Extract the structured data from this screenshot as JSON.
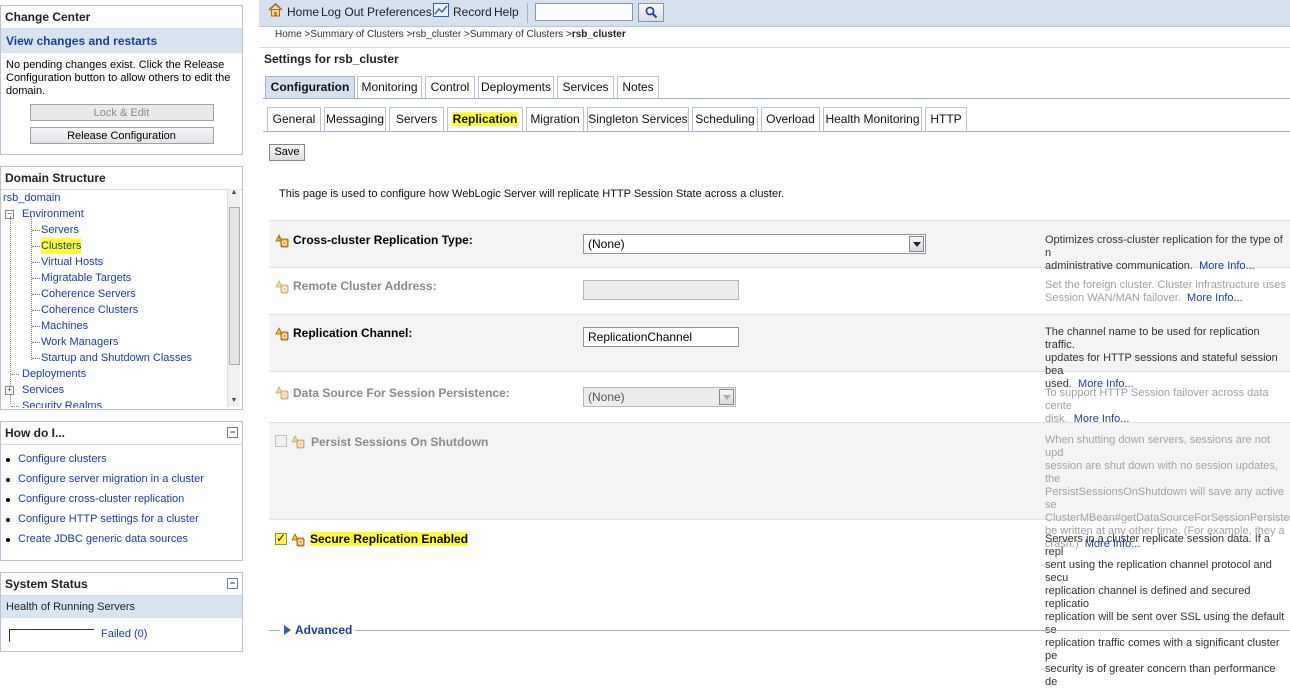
{
  "change_center": {
    "title": "Change Center",
    "view_changes": "View changes and restarts",
    "message": "No pending changes exist. Click the Release Configuration button to allow others to edit the domain.",
    "lock_edit": "Lock & Edit",
    "release": "Release Configuration"
  },
  "domain_structure": {
    "title": "Domain Structure",
    "items": [
      "rsb_domain",
      "Environment",
      "Servers",
      "Clusters",
      "Virtual Hosts",
      "Migratable Targets",
      "Coherence Servers",
      "Coherence Clusters",
      "Machines",
      "Work Managers",
      "Startup and Shutdown Classes",
      "Deployments",
      "Services",
      "Security Realms"
    ]
  },
  "how_do_i": {
    "title": "How do I...",
    "items": [
      "Configure clusters",
      "Configure server migration in a cluster",
      "Configure cross-cluster replication",
      "Configure HTTP settings for a cluster",
      "Create JDBC generic data sources"
    ]
  },
  "system_status": {
    "title": "System Status",
    "health": "Health of Running Servers",
    "failed": "Failed (0)"
  },
  "topbar": {
    "home": "Home",
    "logout": "Log Out",
    "preferences": "Preferences",
    "record": "Record",
    "help": "Help",
    "search_value": ""
  },
  "breadcrumb": {
    "home": "Home",
    "summary_clusters": "Summary of Clusters",
    "cluster": "rsb_cluster",
    "summary_clusters_2": "Summary of Clusters",
    "current": "rsb_cluster"
  },
  "page": {
    "title": "Settings for rsb_cluster",
    "save": "Save",
    "intro": "This page is used to configure how WebLogic Server will replicate HTTP Session State across a cluster."
  },
  "tabs": [
    "Configuration",
    "Monitoring",
    "Control",
    "Deployments",
    "Services",
    "Notes"
  ],
  "subtabs": [
    "General",
    "Messaging",
    "Servers",
    "Replication",
    "Migration",
    "Singleton Services",
    "Scheduling",
    "Overload",
    "Health Monitoring",
    "HTTP"
  ],
  "fields": {
    "cross_cluster": {
      "label": "Cross-cluster Replication Type:",
      "value": "(None)",
      "desc": "Optimizes cross-cluster replication for the type of n\nadministrative communication.",
      "more": "More Info..."
    },
    "remote_address": {
      "label": "Remote Cluster Address:",
      "value": "",
      "desc": "Set the foreign cluster. Cluster infrastructure uses\nSession WAN/MAN failover.",
      "more": "More Info..."
    },
    "replication_channel": {
      "label": "Replication Channel:",
      "value": "ReplicationChannel",
      "desc": "The channel name to be used for replication traffic.\nupdates for HTTP sessions and stateful session bea\nused.",
      "more": "More Info..."
    },
    "data_source": {
      "label": "Data Source For Session Persistence:",
      "value": "(None)",
      "desc": "To support HTTP Session failover across data cente\ndisk.",
      "more": "More Info..."
    },
    "persist_sessions": {
      "label": "Persist Sessions On Shutdown",
      "desc": "When shutting down servers, sessions are not upd\nsession are shut down with no session updates, the\nPersistSessionsOnShutdown will save any active se\nClusterMBean#getDataSourceForSessionPersistenc\nbe written at any other time. (For example, they a\ncrash.)",
      "more": "More Info..."
    },
    "secure_replication": {
      "label": "Secure Replication Enabled",
      "desc": "Servers in a cluster replicate session data. If a repl\nsent using the replication channel protocol and secu\nreplication channel is defined and secured replicatio\nreplication will be sent over SSL using the default se\nreplication traffic comes with a significant cluster pe\nsecurity is of greater concern than performance de"
    }
  },
  "advanced": "Advanced",
  "colors": {
    "header_bg": "#d6e1f0",
    "link": "#1b3e9e",
    "highlight": "#ffff33"
  }
}
